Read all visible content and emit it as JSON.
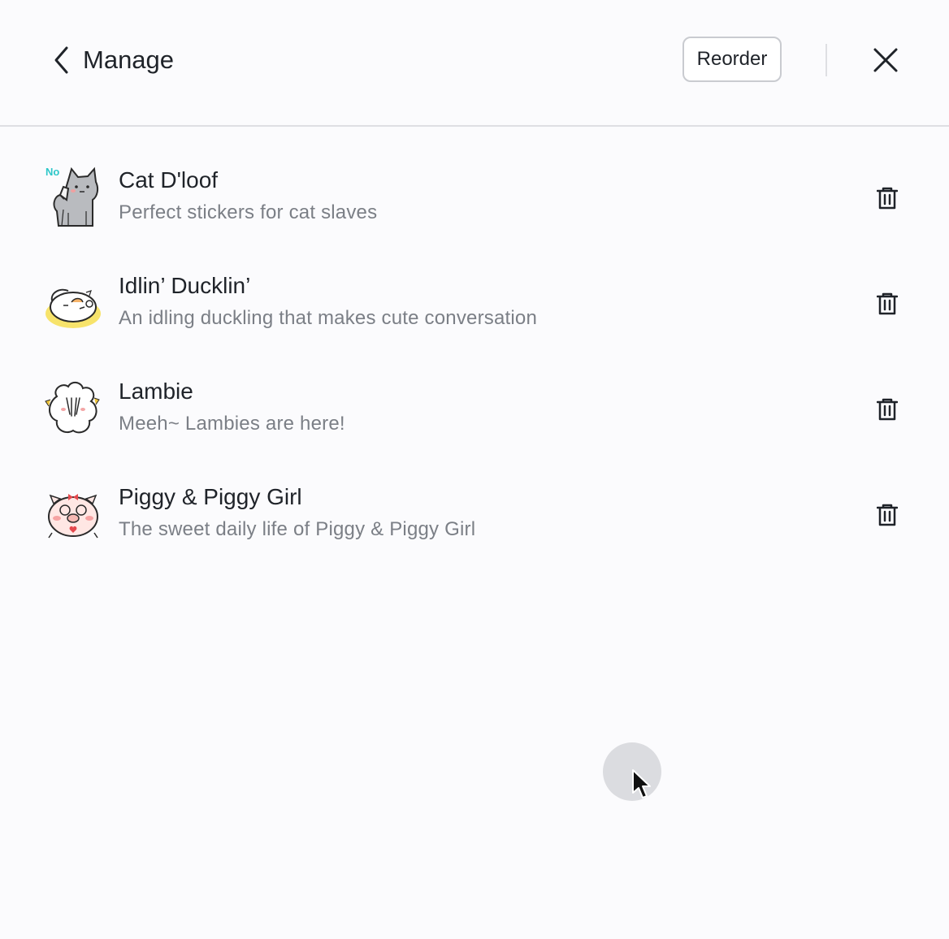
{
  "header": {
    "back_icon": "chevron-left-icon",
    "title": "Manage",
    "reorder_label": "Reorder",
    "close_icon": "close-icon"
  },
  "sticker_packs": [
    {
      "title": "Cat D'loof",
      "description": "Perfect stickers for cat slaves",
      "thumbnail": "gray-cat-sticker",
      "badge_text": "No"
    },
    {
      "title": "Idlin’ Ducklin’",
      "description": "An idling duckling that makes cute conversation",
      "thumbnail": "sleeping-duck-sticker"
    },
    {
      "title": "Lambie",
      "description": "Meeh~ Lambies are here!",
      "thumbnail": "fluffy-lamb-sticker"
    },
    {
      "title": "Piggy & Piggy Girl",
      "description": "The sweet daily life of Piggy & Piggy Girl",
      "thumbnail": "pink-pig-sticker"
    }
  ],
  "delete_icon": "trash-icon",
  "colors": {
    "background": "#fbfbfd",
    "text_primary": "#1f2329",
    "text_secondary": "#7b7f86",
    "divider": "#dedfe3",
    "badge": "#2ec7c9"
  }
}
